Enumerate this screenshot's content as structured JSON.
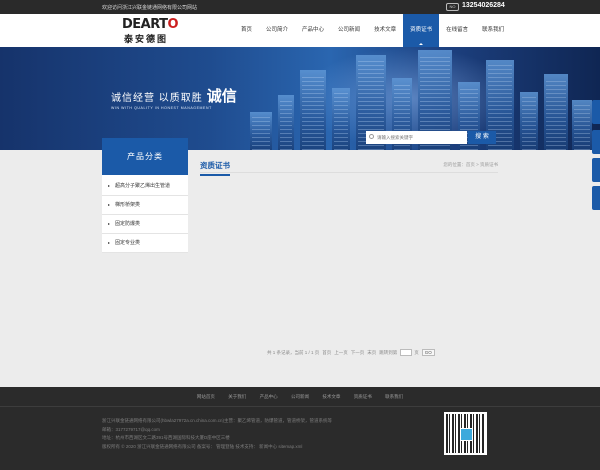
{
  "topbar": {
    "welcome": "欢迎访问浙江兴联金链通网络有限公司网站",
    "phone_icon": "NO",
    "phone": "13254026284"
  },
  "logo": {
    "en_start": "DEART",
    "en_end": "O",
    "cn": "泰安德图"
  },
  "nav": {
    "items": [
      "首页",
      "公司简介",
      "产品中心",
      "公司新闻",
      "技术文章",
      "资质证书",
      "在线留言",
      "联系我们"
    ],
    "active_index": 5
  },
  "banner": {
    "slogan_main": "诚信经营 以质取胜",
    "slogan_strong": "诚信",
    "slogan_en": "WIN WITH QUALITY IN HONEST MANAGEMENT"
  },
  "search": {
    "placeholder": "请输入搜索关键字",
    "button": "搜 索"
  },
  "sidebar": {
    "title": "产品分类",
    "items": [
      "超高分子聚乙烯出生管道",
      "梯形桥架类",
      "固定防爆类",
      "固定专业类"
    ]
  },
  "content": {
    "title": "资质证书",
    "breadcrumb": "您的位置：首页 > 资质证书",
    "pager": {
      "summary": "共 1 条记录，当前 1 / 1 页",
      "first": "首页",
      "prev": "上一页",
      "next": "下一页",
      "last": "末页",
      "goto_label": "跳转到第",
      "page_suffix": "页",
      "go": "GO"
    }
  },
  "footer": {
    "links": [
      "网站首页",
      "关于我们",
      "产品中心",
      "公司新闻",
      "技术文章",
      "资质证书",
      "联系我们"
    ],
    "info": [
      "浙江兴联金链通网络有限公司(hbwla27972a.cn.china.com.cn)主营：聚乙烯管道，防爆管道，管道桥架，管道系统等",
      "邮箱：3177279717@qq.com",
      "地址：杭州市西湖区文二路391号西湖国际科技大厦D座中区三楼",
      "版权所有 © 2020 浙江兴联金链通网络有限公司  备案号：   管理登陆   技术支持：   新闻中心   sitemap.xml"
    ]
  }
}
